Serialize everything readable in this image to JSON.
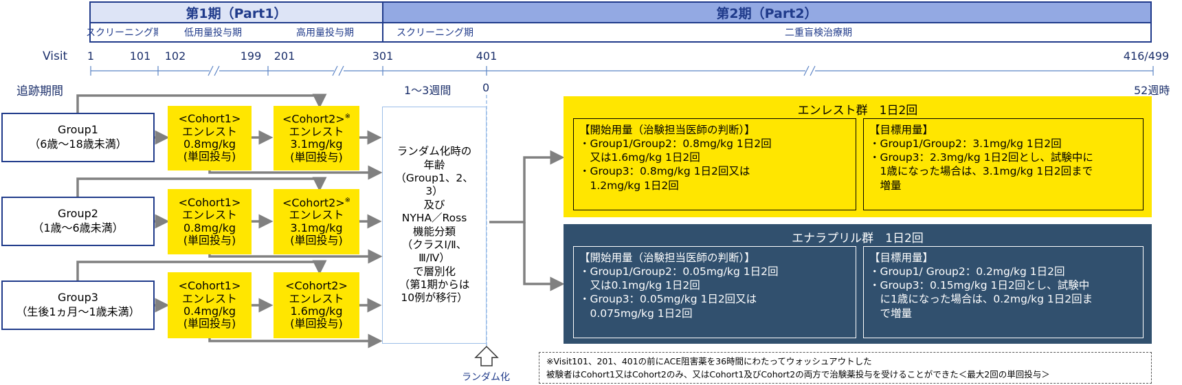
{
  "header": {
    "phase1": "第1期（Part1）",
    "phase2": "第2期（Part2）",
    "sub_screening1": "スクリーニング期",
    "sub_low_dose": "低用量投与期",
    "sub_high_dose": "高用量投与期",
    "sub_screening2": "スクリーニング期",
    "sub_double_blind": "二重盲検治療期"
  },
  "timeline": {
    "visit_label": "Visit",
    "visits": [
      "1",
      "101",
      "102",
      "199",
      "201",
      "301",
      "401",
      "416/499"
    ],
    "followup_label": "追跡期間",
    "week_range": "1～3週間",
    "week_zero": "0",
    "week_end": "52週時"
  },
  "groups": [
    {
      "name": "Group1",
      "age": "（6歳～18歳未満）"
    },
    {
      "name": "Group2",
      "age": "（1歳～6歳未満）"
    },
    {
      "name": "Group3",
      "age": "（生後1ヵ月～1歳未満）"
    }
  ],
  "cohort_rows": [
    {
      "c1": [
        "<Cohort1>",
        "エンレスト",
        "0.8mg/kg",
        "(単回投与)"
      ],
      "c2": [
        "<Cohort2>",
        "エンレスト",
        "3.1mg/kg",
        "(単回投与)"
      ],
      "c2_mark": "※"
    },
    {
      "c1": [
        "<Cohort1>",
        "エンレスト",
        "0.8mg/kg",
        "(単回投与)"
      ],
      "c2": [
        "<Cohort2>",
        "エンレスト",
        "3.1mg/kg",
        "(単回投与)"
      ],
      "c2_mark": "※"
    },
    {
      "c1": [
        "<Cohort1>",
        "エンレスト",
        "0.4mg/kg",
        "(単回投与)"
      ],
      "c2": [
        "<Cohort2>",
        "エンレスト",
        "1.6mg/kg",
        "(単回投与)"
      ],
      "c2_mark": ""
    }
  ],
  "stratification": [
    "ランダム化時の",
    "年齢",
    "（Group1、2、",
    "3）",
    "及び",
    "NYHA／Ross",
    "機能分類",
    "（クラスⅠ/Ⅱ、",
    "Ⅲ/Ⅳ）",
    "で層別化",
    "（第1期からは",
    "10例が移行）"
  ],
  "randomization_label": "ランダム化",
  "arms": [
    {
      "title": "エンレスト群　1日2回",
      "start_title": "【開始用量（治験担当医師の判断）】",
      "start_lines": [
        "・Group1/Group2：0.8mg/kg 1日2回",
        "　又は1.6mg/kg 1日2回",
        "・Group3：0.8mg/kg 1日2回又は",
        "　1.2mg/kg 1日2回"
      ],
      "target_title": "【目標用量】",
      "target_lines": [
        "・Group1/Group2：3.1mg/kg 1日2回",
        "・Group3：2.3mg/kg 1日2回とし、試験中に",
        "　1歳になった場合は、3.1mg/kg 1日2回まで",
        "　増量"
      ]
    },
    {
      "title": "エナラプリル群　1日2回",
      "start_title": "【開始用量（治験担当医師の判断）】",
      "start_lines": [
        "・Group1/Group2：0.05mg/kg 1日2回",
        "　又は0.1mg/kg 1日2回",
        "・Group3：0.05mg/kg 1日2回又は",
        "　0.075mg/kg 1日2回"
      ],
      "target_title": "【目標用量】",
      "target_lines": [
        "・Group1/ Group2：0.2mg/kg 1日2回",
        "・Group3：0.15mg/kg 1日2回とし、試験中",
        "　に1歳になった場合は、0.2mg/kg 1日2回ま",
        "　で増量"
      ]
    }
  ],
  "footnote": [
    "※Visit101、201、401の前にACE阻害薬を36時間にわたってウォッシュアウトした",
    "被験者はCohort1又はCohort2のみ、又はCohort1及びCohort2の両方で治験薬投与を受けることができた＜最大2回の単回投与＞"
  ],
  "colors": {
    "navy": "#1f3a8a",
    "yellow": "#ffe600",
    "arm_navy": "#31506e",
    "arrow_gray": "#808080"
  }
}
